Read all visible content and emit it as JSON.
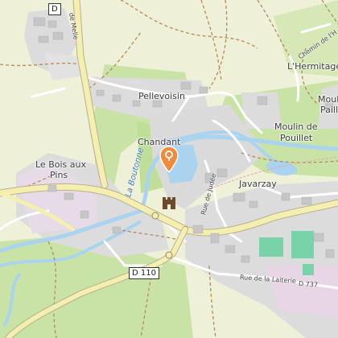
{
  "places": {
    "pellevoisin": "Pellevoisin",
    "chandant": "Chandant",
    "le_bois_aux_pins_l1": "Le Bois aux",
    "le_bois_aux_pins_l2": "Pins",
    "lhermitage": "L'Hermitage",
    "moulin_de_pouillet_l1": "Moulin de",
    "moulin_de_pouillet_l2": "Pouillet",
    "moulin_paille_l1": "Moul",
    "moulin_paille_l2": "Paill",
    "javarzay": "Javarzay"
  },
  "roads": {
    "route_de_melle": "de Melle",
    "rue_de_judee": "Rue de Judée",
    "chemin_de_lhermitage": "Chemin de l'H",
    "rue_de_la_laiterie": "Rue de la Laiterie",
    "d737": "D 737",
    "d110": "D 110",
    "d_top": "D"
  },
  "river": {
    "name": "La Boutonne"
  },
  "poi": {
    "marker_icon": "map-pin-icon",
    "castle_icon": "castle-icon"
  },
  "colors": {
    "land": "#eef0d8",
    "forest": "#c9e3a6",
    "residential": "#dcdcdc",
    "water": "#a9d3ee",
    "marker": "#f08a3c",
    "major_road": "#f4efb0"
  }
}
